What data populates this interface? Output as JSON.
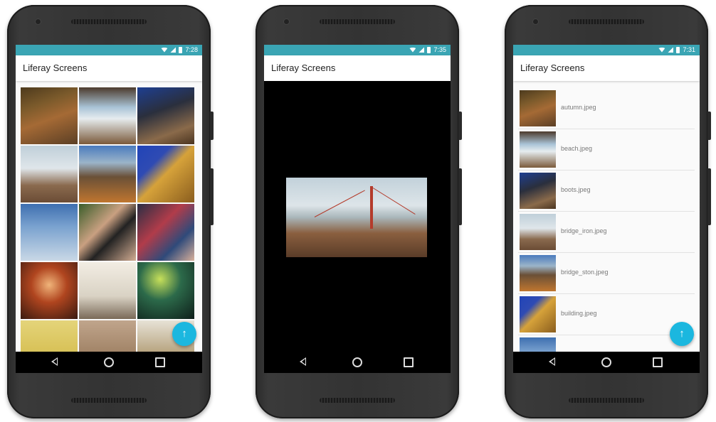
{
  "phones": [
    {
      "status_time": "7:28",
      "app_title": "Liferay Screens",
      "view": "grid",
      "fab_icon": "arrow-up-icon",
      "grid_images": [
        "autumn",
        "beach",
        "boots",
        "bridge",
        "ston",
        "building",
        "tower",
        "camera",
        "shirt",
        "fire",
        "room",
        "party",
        "macaron",
        "pastry",
        "food"
      ]
    },
    {
      "status_time": "7:35",
      "app_title": "Liferay Screens",
      "view": "image-viewer",
      "image": "bridge"
    },
    {
      "status_time": "7:31",
      "app_title": "Liferay Screens",
      "view": "list",
      "fab_icon": "arrow-up-icon",
      "files": [
        {
          "name": "autumn.jpeg",
          "image": "autumn"
        },
        {
          "name": "beach.jpeg",
          "image": "beach"
        },
        {
          "name": "boots.jpeg",
          "image": "boots"
        },
        {
          "name": "bridge_iron.jpeg",
          "image": "bridge"
        },
        {
          "name": "bridge_ston.jpeg",
          "image": "ston"
        },
        {
          "name": "building.jpeg",
          "image": "building"
        },
        {
          "name": "",
          "image": "tower"
        }
      ]
    }
  ],
  "icons": {
    "fab": "↑",
    "wifi": "wifi-icon",
    "signal": "signal-icon",
    "battery": "battery-icon",
    "nav_back": "back-icon",
    "nav_home": "home-icon",
    "nav_recent": "recent-apps-icon"
  },
  "colors": {
    "statusbar": "#3aa5b4",
    "fab": "#1bb7df"
  }
}
